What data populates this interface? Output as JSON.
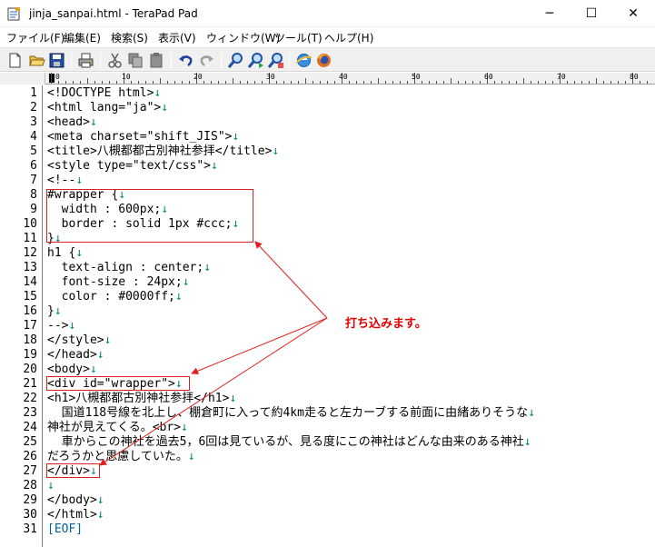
{
  "window": {
    "title": "jinja_sanpai.html - TeraPad  Pad"
  },
  "window_controls": {
    "minimize": "─",
    "maximize": "☐",
    "close": "✕"
  },
  "menu": [
    {
      "label": "ファイル(F)"
    },
    {
      "label": "編集(E)"
    },
    {
      "label": "検索(S)"
    },
    {
      "label": "表示(V)"
    },
    {
      "label": "ウィンドウ(W)"
    },
    {
      "label": "ツール(T)"
    },
    {
      "label": "ヘルプ(H)"
    }
  ],
  "toolbar_icons": [
    "new-file-icon",
    "open-folder-icon",
    "save-icon",
    "print-icon",
    "cut-icon",
    "copy-icon",
    "paste-icon",
    "undo-icon",
    "redo-icon",
    "find-icon",
    "find-next-icon",
    "replace-icon",
    "browser-icon",
    "firefox-icon"
  ],
  "ruler": {
    "labels": [
      "0",
      "10",
      "20",
      "30",
      "40",
      "50",
      "60",
      "70",
      "80"
    ]
  },
  "editor": {
    "lines": [
      {
        "num": "1",
        "text": "<!DOCTYPE html>"
      },
      {
        "num": "2",
        "text": "<html lang=\"ja\">"
      },
      {
        "num": "3",
        "text": "<head>"
      },
      {
        "num": "4",
        "text": "<meta charset=\"shift_JIS\">"
      },
      {
        "num": "5",
        "text": "<title>八槻都都古別神社参拝</title>"
      },
      {
        "num": "6",
        "text": "<style type=\"text/css\">"
      },
      {
        "num": "7",
        "text": "<!--"
      },
      {
        "num": "8",
        "text": "#wrapper {"
      },
      {
        "num": "9",
        "text": "  width : 600px;"
      },
      {
        "num": "10",
        "text": "  border : solid 1px #ccc;"
      },
      {
        "num": "11",
        "text": "}"
      },
      {
        "num": "12",
        "text": "h1 {"
      },
      {
        "num": "13",
        "text": "  text-align : center;"
      },
      {
        "num": "14",
        "text": "  font-size : 24px;"
      },
      {
        "num": "15",
        "text": "  color : #0000ff;"
      },
      {
        "num": "16",
        "text": "}"
      },
      {
        "num": "17",
        "text": "-->"
      },
      {
        "num": "18",
        "text": "</style>"
      },
      {
        "num": "19",
        "text": "</head>"
      },
      {
        "num": "20",
        "text": "<body>"
      },
      {
        "num": "21",
        "text": "<div id=\"wrapper\">"
      },
      {
        "num": "22",
        "text": "<h1>八槻都都古別神社参拝</h1>"
      },
      {
        "num": "23",
        "text": "  国道118号線を北上し、棚倉町に入って約4km走ると左カーブする前面に由緒ありそうな"
      },
      {
        "num": "24",
        "text": "神社が見えてくる。<br>"
      },
      {
        "num": "25",
        "text": "  車からこの神社を過去5，6回は見ているが、見る度にこの神社はどんな由来のある神社"
      },
      {
        "num": "26",
        "text": "だろうかと思慮していた。"
      },
      {
        "num": "27",
        "text": "</div>"
      },
      {
        "num": "28",
        "text": ""
      },
      {
        "num": "29",
        "text": "</body>"
      },
      {
        "num": "30",
        "text": "</html>"
      },
      {
        "num": "31",
        "text": "[EOF]"
      }
    ],
    "newline_mark": "↓"
  },
  "annotation": {
    "text": "打ち込みます。"
  },
  "colors": {
    "highlight": "#e02020",
    "annotation": "#e00000",
    "newline": "#008080"
  }
}
